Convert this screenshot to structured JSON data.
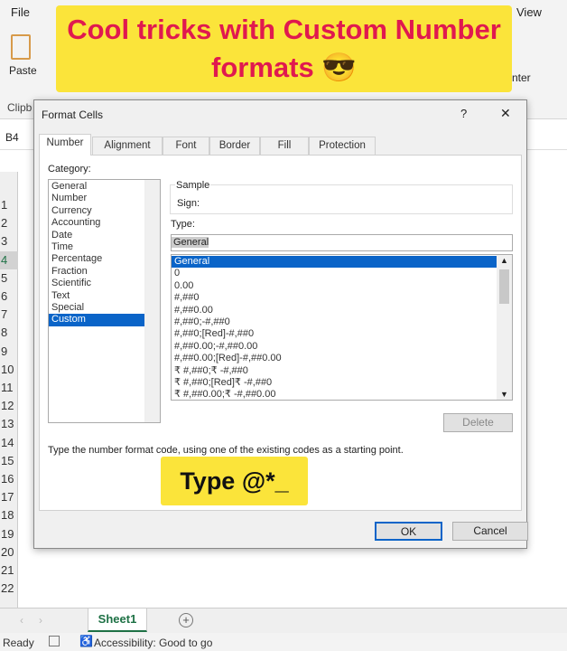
{
  "ribbon": {
    "file_tab": "File",
    "view_tab": "View",
    "paste_label": "Paste",
    "clipboard_group": "Clipb",
    "center_label": "nter"
  },
  "banner": {
    "line1": "Cool tricks with Custom Number",
    "line2": "formats 😎"
  },
  "name_box": "B4",
  "rows": [
    "1",
    "2",
    "3",
    "4",
    "5",
    "6",
    "7",
    "8",
    "9",
    "10",
    "11",
    "12",
    "13",
    "14",
    "15",
    "16",
    "17",
    "18",
    "19",
    "20",
    "21",
    "22"
  ],
  "dialog": {
    "title": "Format Cells",
    "help": "?",
    "close": "✕",
    "tabs": [
      "Number",
      "Alignment",
      "Font",
      "Border",
      "Fill",
      "Protection"
    ],
    "category_label": "Category:",
    "categories": [
      "General",
      "Number",
      "Currency",
      "Accounting",
      "Date",
      "Time",
      "Percentage",
      "Fraction",
      "Scientific",
      "Text",
      "Special",
      "Custom"
    ],
    "selected_category": "Custom",
    "sample_label": "Sample",
    "sample_value": "Sign:",
    "type_label": "Type:",
    "type_value": "General",
    "formats": [
      "General",
      "0",
      "0.00",
      "#,##0",
      "#,##0.00",
      "#,##0;-#,##0",
      "#,##0;[Red]-#,##0",
      "#,##0.00;-#,##0.00",
      "#,##0.00;[Red]-#,##0.00",
      "₹ #,##0;₹ -#,##0",
      "₹ #,##0;[Red]₹ -#,##0",
      "₹ #,##0.00;₹ -#,##0.00"
    ],
    "delete_label": "Delete",
    "description": "Type the number format code, using one of the existing codes as a starting point.",
    "ok_label": "OK",
    "cancel_label": "Cancel"
  },
  "overlay_caption": "Type @*_",
  "sheet_tab": "Sheet1",
  "status": {
    "ready": "Ready",
    "accessibility": "Accessibility: Good to go"
  }
}
